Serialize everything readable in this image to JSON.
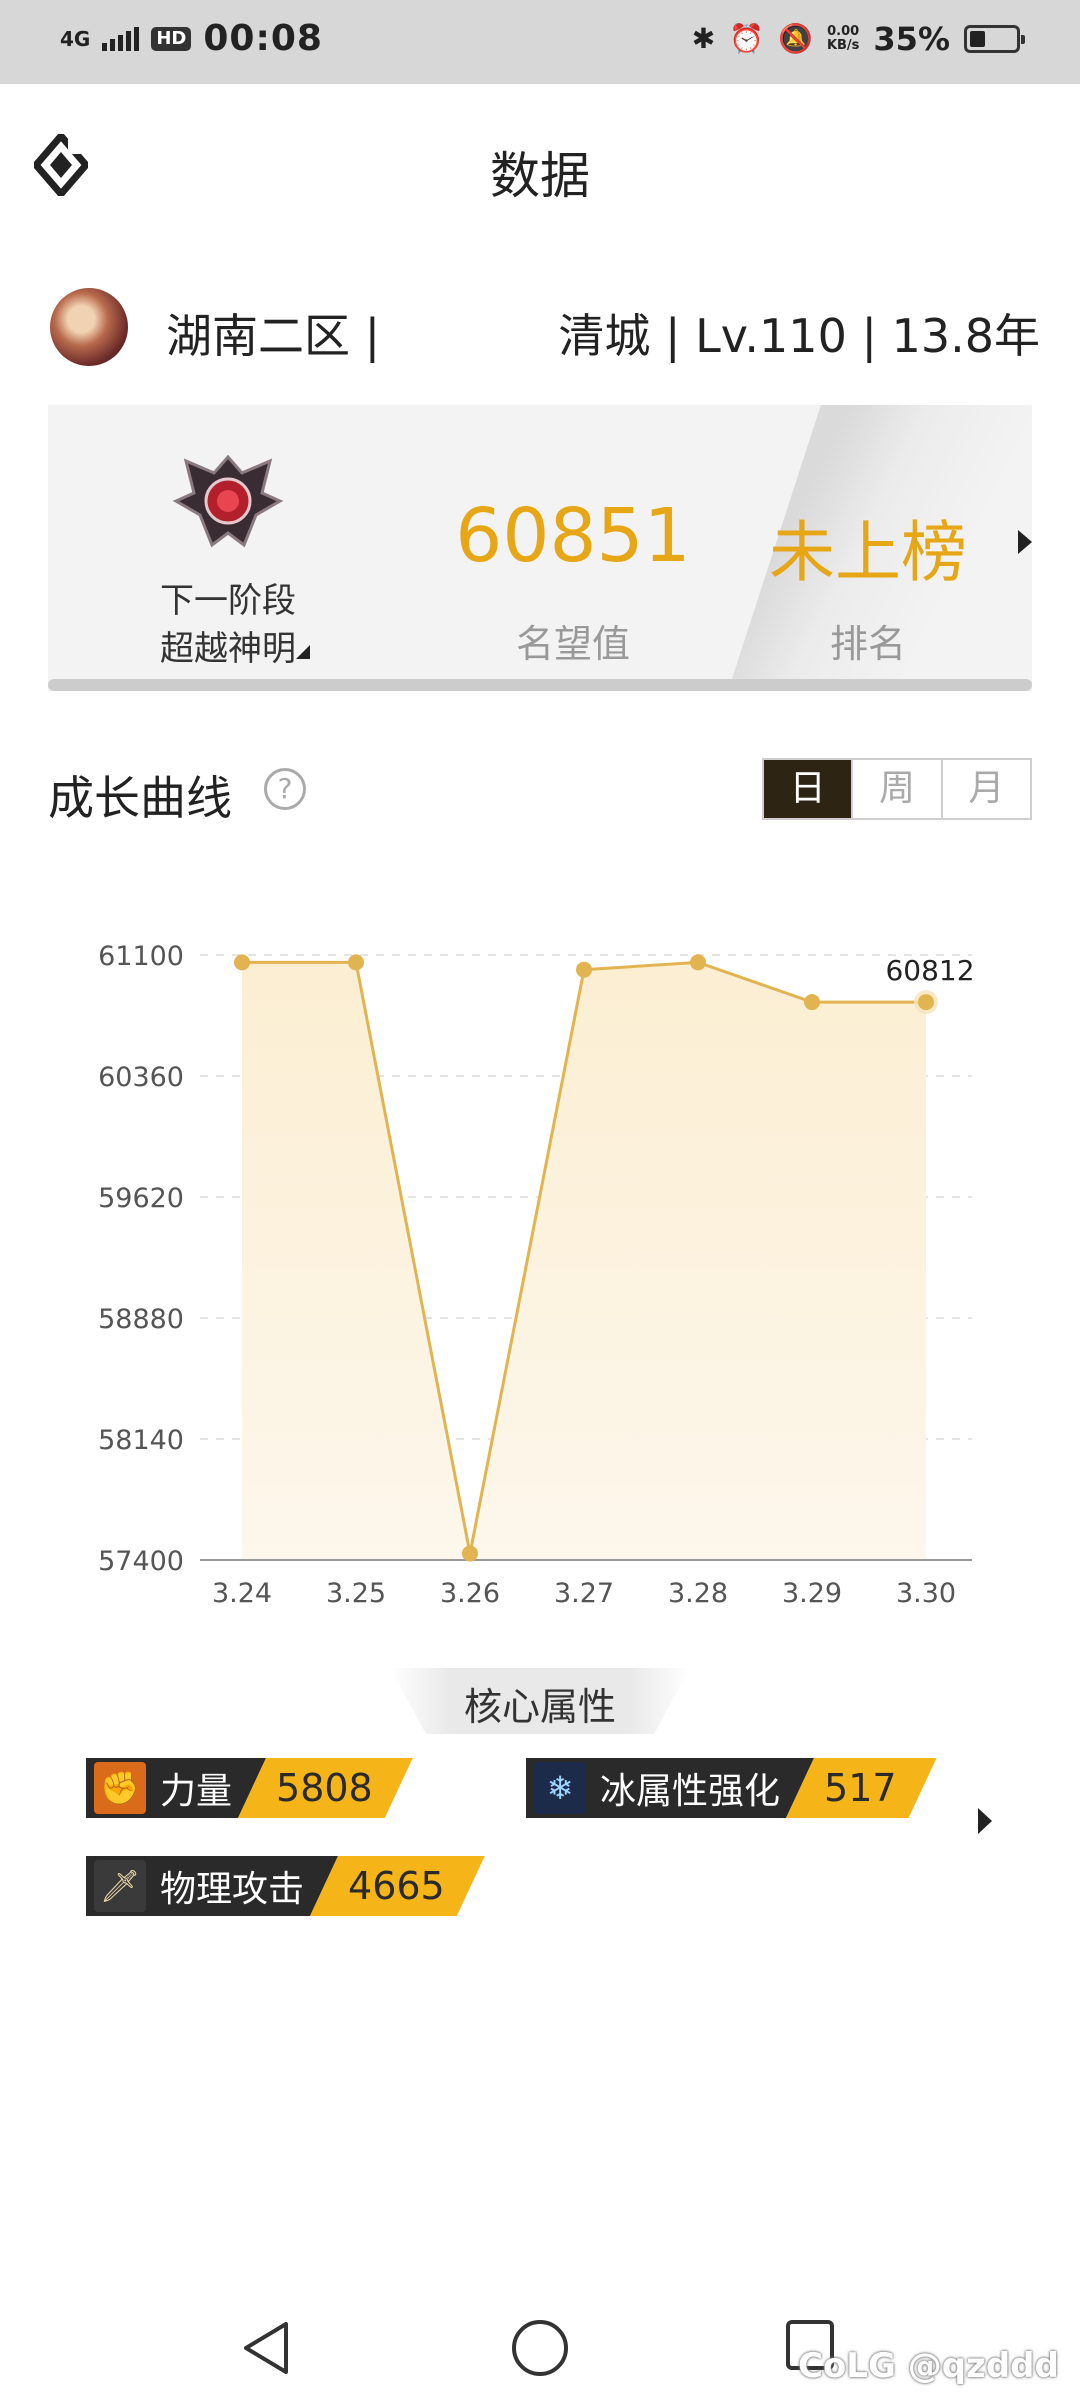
{
  "status_bar": {
    "signal": "4G",
    "hd": "HD",
    "time": "00:08",
    "net_speed_value": "0.00",
    "net_speed_unit": "KB/s",
    "battery": "35%",
    "battery_level": 0.35
  },
  "header": {
    "title": "数据"
  },
  "profile": {
    "server": "湖南二区 |",
    "player_info": "清城 | Lv.110 | 13.8年"
  },
  "fame_card": {
    "stage_line1": "下一阶段",
    "stage_line2": "超越神明",
    "fame_value": "60851",
    "fame_label": "名望值",
    "rank_value": "未上榜",
    "rank_label": "排名"
  },
  "growth": {
    "title": "成长曲线",
    "help": "?",
    "tabs": [
      "日",
      "周",
      "月"
    ],
    "active_tab": "日"
  },
  "chart_data": {
    "type": "area",
    "categories": [
      "3.24",
      "3.25",
      "3.26",
      "3.27",
      "3.28",
      "3.29",
      "3.30"
    ],
    "values": [
      61055,
      61055,
      57440,
      61010,
      61055,
      60812,
      60812
    ],
    "y_ticks": [
      "61100",
      "60360",
      "59620",
      "58880",
      "58140",
      "57400"
    ],
    "ylim": [
      57400,
      61100
    ],
    "last_label": "60812",
    "line_color": "#e2b451",
    "grid": true
  },
  "core": {
    "title": "核心属性",
    "attributes": [
      {
        "name": "力量",
        "value": "5808",
        "icon": "fist-icon"
      },
      {
        "name": "冰属性强化",
        "value": "517",
        "icon": "ice-crystal-icon"
      },
      {
        "name": "物理攻击",
        "value": "4665",
        "icon": "sword-icon"
      }
    ]
  },
  "watermark": "CoLG @qzddd"
}
